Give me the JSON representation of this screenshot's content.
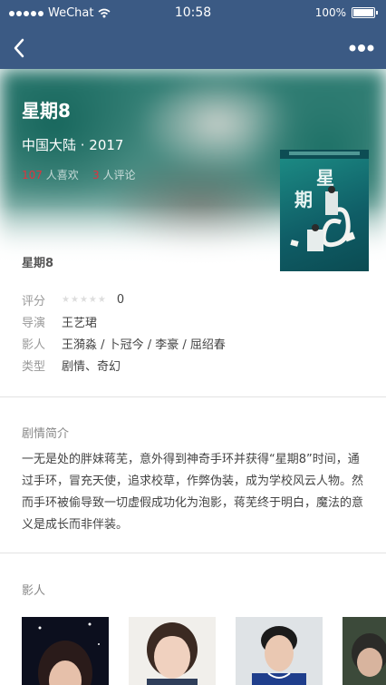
{
  "status_bar": {
    "carrier": "WeChat",
    "time": "10:58",
    "battery": "100%"
  },
  "movie": {
    "title": "星期8",
    "region_year": "中国大陆 · 2017",
    "likes": "107",
    "likes_label": "人喜欢",
    "comments": "3",
    "comments_label": "人评论",
    "short_title": "星期8",
    "poster_text": "星期8"
  },
  "details": {
    "rating_label": "评分",
    "rating_value": "0",
    "director_label": "导演",
    "director": "王艺珺",
    "cast_label": "影人",
    "cast": "王漪淼 / 卜冠今 / 李豪 / 屈绍春",
    "genre_label": "类型",
    "genre": "剧情、奇幻"
  },
  "synopsis": {
    "title": "剧情简介",
    "text": "一无是处的胖妹蒋芜，意外得到神奇手环并获得“星期8”时间，通过手环，冒充天使，追求校草，作弊伪装，成为学校风云人物。然而手环被偷导致一切虚假成功化为泡影，蒋芜终于明白，魔法的意义是成长而非伴装。"
  },
  "cast_section": {
    "title": "影人"
  },
  "colors": {
    "nav": "#3b5a84",
    "accent": "#e0323d"
  }
}
